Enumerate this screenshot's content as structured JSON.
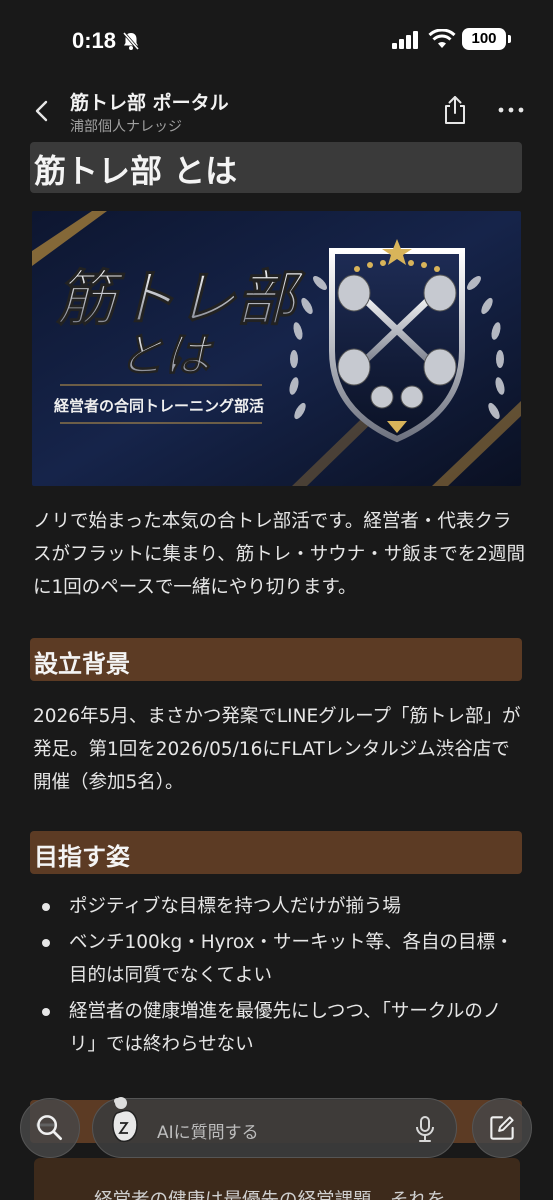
{
  "status_bar": {
    "time": "0:18",
    "battery": "100"
  },
  "header": {
    "title": "筋トレ部 ポータル",
    "subtitle": "浦部個人ナレッジ"
  },
  "page": {
    "heading": "筋トレ部 とは",
    "hero_image": {
      "title_line1": "筋トレ部",
      "title_line2": "とは",
      "tagline": "経営者の合同トレーニング部活"
    },
    "intro": "ノリで始まった本気の合トレ部活です。経営者・代表クラスがフラットに集まり、筋トレ・サウナ・サ飯までを2週間に1回のペースで一緒にやり切ります。",
    "sections": [
      {
        "heading": "設立背景",
        "body": "2026年5月、まさかつ発案でLINEグループ「筋トレ部」が発足。第1回を2026/05/16にFLATレンタルジム渋谷店で開催（参加5名）。"
      },
      {
        "heading": "目指す姿",
        "bullets": [
          "ポジティブな目標を持つ人だけが揃う場",
          "ベンチ100kg・Hyrox・サーキット等、各自の目標・目的は同質でなくてよい",
          "経営者の健康増進を最優先にしつつ、「サークルのノリ」では終わらせない"
        ]
      }
    ],
    "partial_heading": "ー",
    "partial_callout": "経営者の健康は最優先の経営課題。それを"
  },
  "bottom_bar": {
    "ai_placeholder": "AIに質問する"
  },
  "colors": {
    "background": "#191919",
    "h1_background": "#3a3a3a",
    "h2_background": "#5c3b24",
    "callout_background": "#3d2a1b"
  }
}
